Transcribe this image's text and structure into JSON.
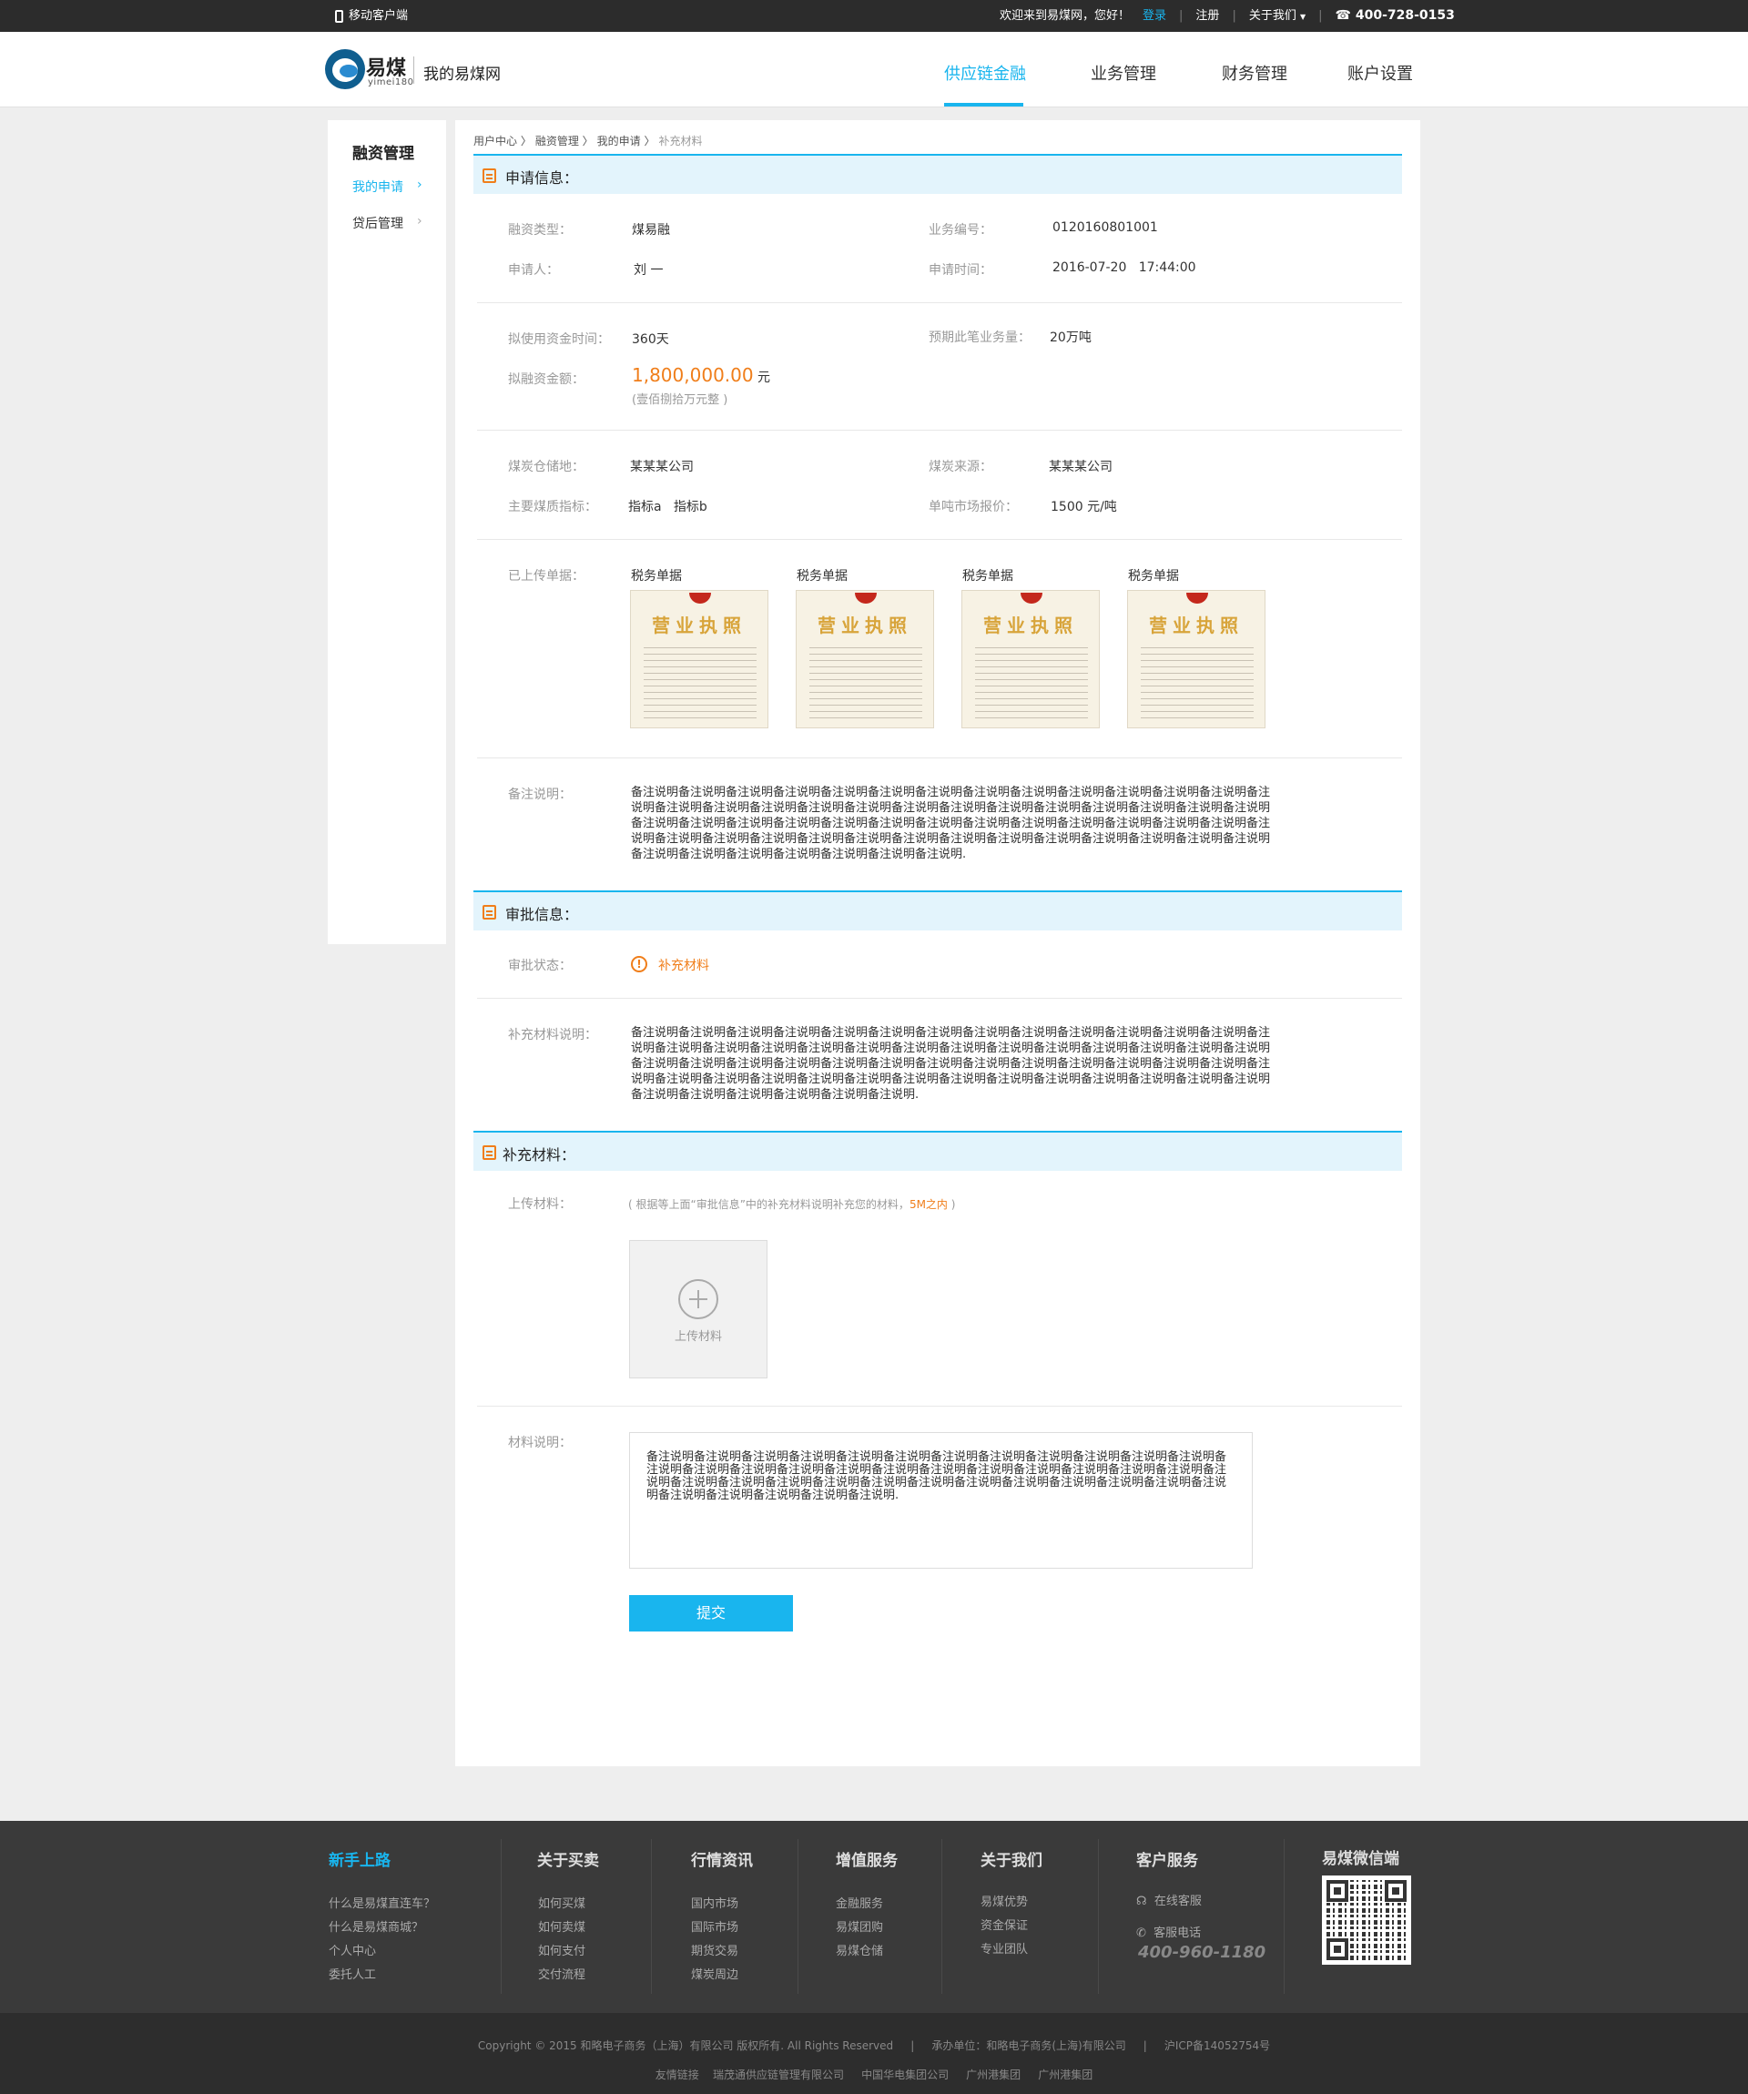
{
  "topbar": {
    "mobile": "移动客户端",
    "welcome": "欢迎来到易煤网，您好！",
    "login": "登录",
    "register": "注册",
    "about": "关于我们",
    "tel": "400-728-0153"
  },
  "header": {
    "logo_cn": "易煤",
    "logo_en": "yimei180",
    "site_title": "我的易煤网",
    "nav": [
      "供应链金融",
      "业务管理",
      "财务管理",
      "账户设置"
    ]
  },
  "sidebar": {
    "title": "融资管理",
    "items": [
      "我的申请",
      "贷后管理"
    ]
  },
  "breadcrumb": [
    "用户中心 〉",
    "融资管理 〉",
    "我的申请 〉",
    "补充材料"
  ],
  "apply": {
    "title": "申请信息：",
    "finance_type_label": "融资类型：",
    "finance_type": "煤易融",
    "biz_no_label": "业务编号：",
    "biz_no": "0120160801001",
    "applicant_label": "申请人：",
    "applicant": "刘 一",
    "apply_time_label": "申请时间：",
    "apply_time": "2016-07-20   17:44:00",
    "fund_days_label": "拟使用资金时间：",
    "fund_days": "360天",
    "volume_label": "预期此笔业务量：",
    "volume": "20万吨",
    "amount_label": "拟融资金额：",
    "amount": "1,800,000.00",
    "amount_unit": "元",
    "amount_cn": "(壹佰捌拾万元整 )",
    "storage_label": "煤炭仓储地：",
    "storage": "某某某公司",
    "source_label": "煤炭来源：",
    "source": "某某某公司",
    "quality_label": "主要煤质指标：",
    "quality": "指标a   指标b",
    "price_label": "单吨市场报价：",
    "price": "1500 元/吨",
    "uploaded_label": "已上传单据：",
    "docs": [
      {
        "caption": "税务单据",
        "title": "营业执照"
      },
      {
        "caption": "税务单据",
        "title": "营业执照"
      },
      {
        "caption": "税务单据",
        "title": "营业执照"
      },
      {
        "caption": "税务单据",
        "title": "营业执照"
      }
    ],
    "remark_label": "备注说明：",
    "remark": "备注说明备注说明备注说明备注说明备注说明备注说明备注说明备注说明备注说明备注说明备注说明备注说明备注说明备注说明备注说明备注说明备注说明备注说明备注说明备注说明备注说明备注说明备注说明备注说明备注说明备注说明备注说明备注说明备注说明备注说明备注说明备注说明备注说明备注说明备注说明备注说明备注说明备注说明备注说明备注说明备注说明备注说明备注说明备注说明备注说明备注说明备注说明备注说明备注说明备注说明备注说明备注说明备注说明备注说明备注说明备注说明备注说明备注说明备注说明备注说明备注说明."
  },
  "approval": {
    "title": "审批信息：",
    "status_label": "审批状态：",
    "status": "补充材料",
    "desc_label": "补充材料说明：",
    "desc": "备注说明备注说明备注说明备注说明备注说明备注说明备注说明备注说明备注说明备注说明备注说明备注说明备注说明备注说明备注说明备注说明备注说明备注说明备注说明备注说明备注说明备注说明备注说明备注说明备注说明备注说明备注说明备注说明备注说明备注说明备注说明备注说明备注说明备注说明备注说明备注说明备注说明备注说明备注说明备注说明备注说明备注说明备注说明备注说明备注说明备注说明备注说明备注说明备注说明备注说明备注说明备注说明备注说明备注说明备注说明备注说明备注说明备注说明备注说明备注说明."
  },
  "supplement": {
    "title": "补充材料：",
    "upload_label": "上传材料：",
    "hint_pre": "( 根据等上面“审批信息”中的补充材料说明补充您的材料，",
    "hint_hl": "5M之内",
    "hint_post": " )",
    "upload_btn": "上传材料",
    "material_label": "材料说明：",
    "material_text": "备注说明备注说明备注说明备注说明备注说明备注说明备注说明备注说明备注说明备注说明备注说明备注说明备注说明备注说明备注说明备注说明备注说明备注说明备注说明备注说明备注说明备注说明备注说明备注说明备注说明备注说明备注说明备注说明备注说明备注说明备注说明备注说明备注说明备注说明备注说明备注说明备注说明备注说明备注说明备注说明备注说明备注说明.",
    "submit": "提交"
  },
  "footer": {
    "cols": [
      {
        "title": "新手上路",
        "links": [
          "什么是易煤直连车？",
          "什么是易煤商城？",
          "个人中心",
          "委托人工"
        ]
      },
      {
        "title": "关于买卖",
        "links": [
          "如何买煤",
          "如何卖煤",
          "如何支付",
          "交付流程"
        ]
      },
      {
        "title": "行情资讯",
        "links": [
          "国内市场",
          "国际市场",
          "期货交易",
          "煤炭周边"
        ]
      },
      {
        "title": "增值服务",
        "links": [
          "金融服务",
          "易煤团购",
          "易煤仓储"
        ]
      },
      {
        "title": "关于我们",
        "links": [
          "易煤优势",
          "资金保证",
          "专业团队"
        ]
      }
    ],
    "service_title": "客户服务",
    "online": "在线客服",
    "hotline_label": "客服电话",
    "hotline": "400-960-1180",
    "wechat_title": "易煤微信端",
    "copyright": "Copyright © 2015 和略电子商务（上海）有限公司 版权所有. All Rights Reserved     |     承办单位：和略电子商务(上海)有限公司     |     沪ICP备14052754号",
    "friends": "友情链接    瑞茂通供应链管理有限公司     中国华电集团公司     广州港集团     广州港集团"
  },
  "colors": {
    "accent": "#19b5ee",
    "warn": "#f07e1a"
  }
}
